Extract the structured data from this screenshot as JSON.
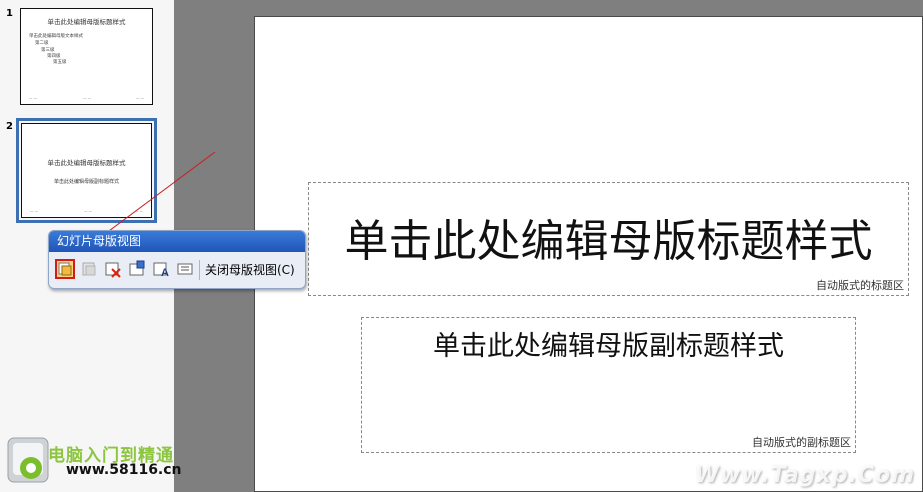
{
  "thumbnails": [
    {
      "number": "1",
      "title": "单击此处编辑母版标题样式",
      "lines": [
        "单击此处编辑母版文本样式",
        "第二级",
        "第三级",
        "第四级",
        "第五级"
      ]
    },
    {
      "number": "2",
      "title": "单击此处编辑母版标题样式",
      "subtitle": "单击此处编辑母版副标题样式"
    }
  ],
  "slide": {
    "title_text": "单击此处编辑母版标题样式",
    "title_label": "自动版式的标题区",
    "subtitle_text": "单击此处编辑母版副标题样式",
    "subtitle_label": "自动版式的副标题区"
  },
  "toolbar": {
    "title": "幻灯片母版视图",
    "close_label": "关闭母版视图(C)",
    "buttons": [
      "insert-slide-master-icon",
      "insert-title-master-icon",
      "delete-master-icon",
      "preserve-master-icon",
      "rename-master-icon",
      "master-layout-icon"
    ]
  },
  "logo": {
    "name": "电脑入门到精通",
    "url": "www.58116.cn"
  },
  "watermark": "Www.Tagxp.Com",
  "colors": {
    "toolbar_title_bg": "#2b66c8",
    "selection_border": "#3c70b0",
    "active_button_border": "#d51a1a",
    "logo_green": "#8cc63f"
  }
}
